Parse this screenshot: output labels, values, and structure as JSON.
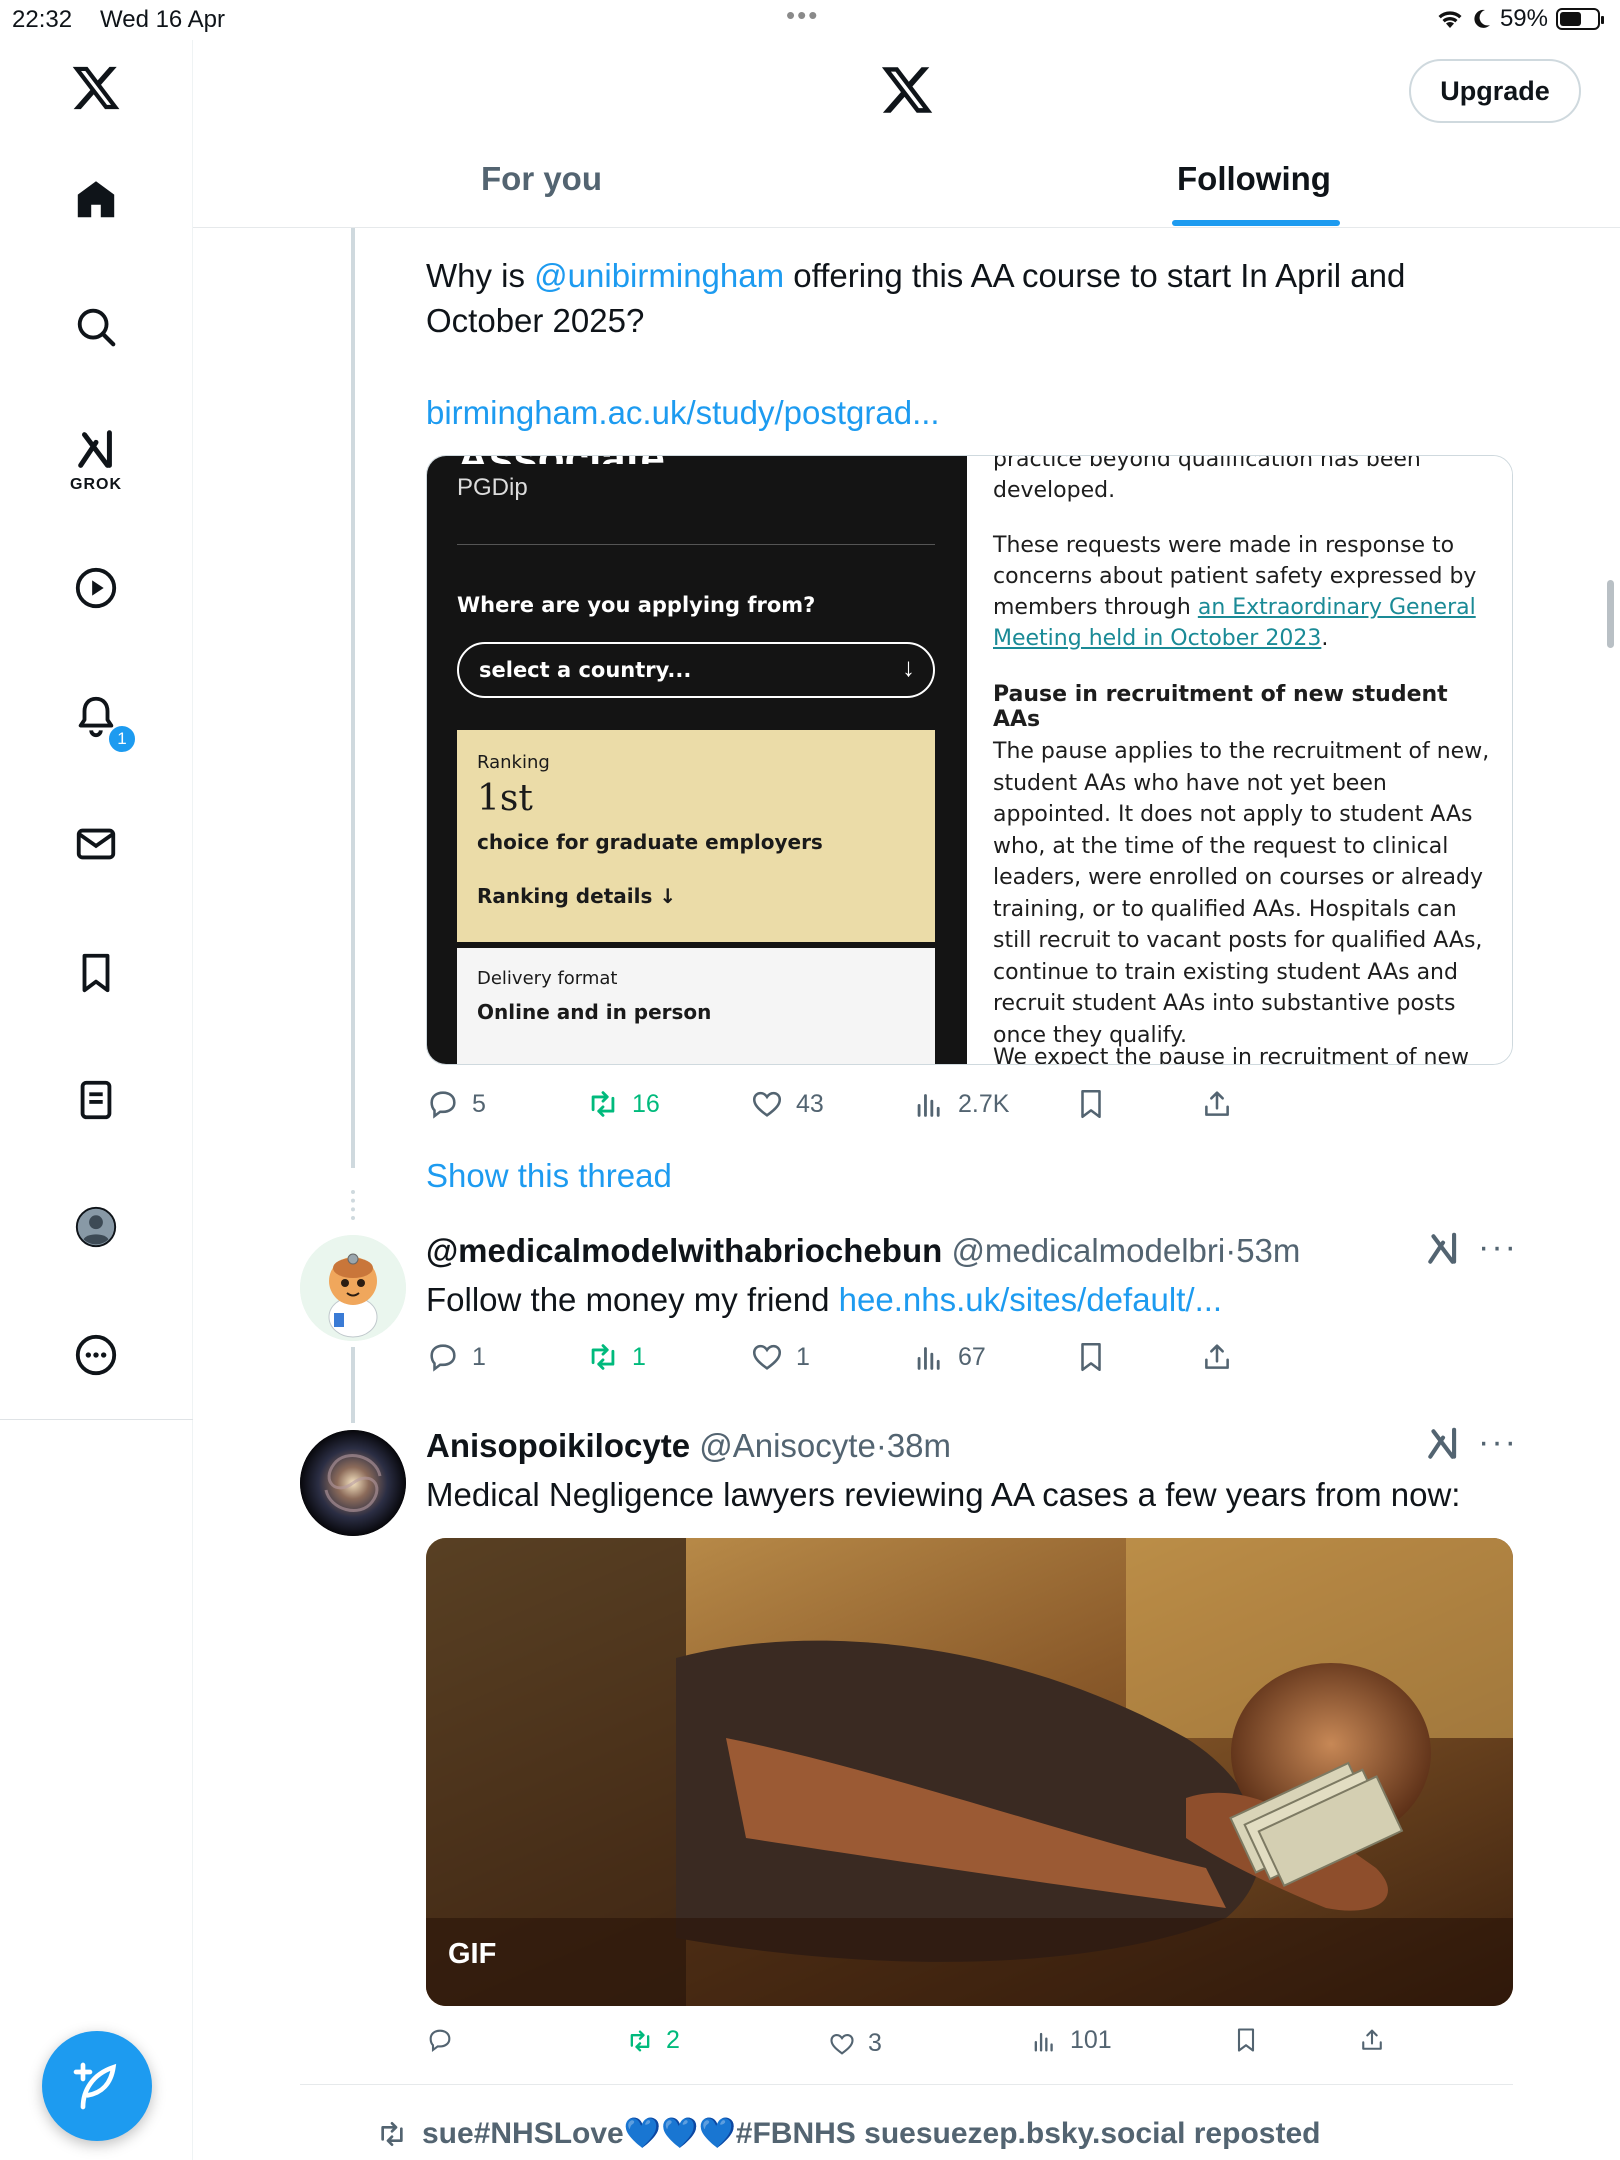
{
  "status_bar": {
    "time": "22:32",
    "date": "Wed 16 Apr",
    "battery": "59%",
    "battery_level": 0.59
  },
  "sidebar": {
    "grok_label": "GROK",
    "notification_count": "1"
  },
  "header": {
    "upgrade_label": "Upgrade",
    "tabs": [
      {
        "label": "For you",
        "active": false
      },
      {
        "label": "Following",
        "active": true
      }
    ]
  },
  "tweet1": {
    "text_before": "Why is ",
    "mention": "@unibirmingham",
    "text_after": " offering this AA course to start In April and October 2025?",
    "link": "birmingham.ac.uk/study/postgrad...",
    "card_left": {
      "heading_cut": "Associate",
      "subtitle": "PGDip",
      "question": "Where are you applying from?",
      "select_placeholder": "select a country...",
      "ranking_label": "Ranking",
      "ranking_value": "1st",
      "ranking_desc": "choice for graduate employers",
      "ranking_details": "Ranking details",
      "delivery_label": "Delivery format",
      "delivery_value": "Online and in person"
    },
    "card_right": {
      "line_top": "practice beyond qualification has been developed.",
      "para1_a": "These requests were made in response to concerns about patient safety expressed by members through ",
      "para1_link": "an Extraordinary General Meeting held in October 2023",
      "para1_b": ".",
      "heading": "Pause in recruitment of new student AAs",
      "para2": "The pause applies to the recruitment of new, student AAs who have not yet been appointed. It does not apply to student AAs who, at the time of the request to clinical leaders, were enrolled on courses or already training, or to qualified AAs. Hospitals can still recruit to vacant posts for qualified AAs, continue to train existing student AAs and recruit student AAs into substantive posts once they qualify.",
      "para3_cut": "We expect the pause in recruitment of new"
    },
    "stats": {
      "replies": "5",
      "reposts": "16",
      "likes": "43",
      "views": "2.7K"
    },
    "show_thread": "Show this thread"
  },
  "tweet2": {
    "name": "@medicalmodelwithabriochebun",
    "handle": "@medicalmodelbri",
    "time": "53m",
    "text": "Follow the money my friend ",
    "link": "hee.nhs.uk/sites/default/...",
    "stats": {
      "replies": "1",
      "reposts": "1",
      "likes": "1",
      "views": "67"
    }
  },
  "tweet3": {
    "name": "Anisopoikilocyte",
    "handle": "@Anisocyte",
    "time": "38m",
    "text": "Medical Negligence lawyers reviewing AA cases a few years from now:",
    "media_badge": "GIF",
    "stats": {
      "replies": "",
      "reposts": "2",
      "likes": "3",
      "views": "101"
    }
  },
  "repost_bar": {
    "text": "sue#NHSLove💙💙💙#FBNHS suesuezep.bsky.social reposted"
  },
  "colors": {
    "accent": "#1d9bf0",
    "repost_green": "#00ba7c",
    "muted": "#536471",
    "ranking_bg": "#ebdca8"
  },
  "icons": [
    "x-logo-icon",
    "home-icon",
    "search-icon",
    "grok-icon",
    "video-icon",
    "bell-icon",
    "mail-icon",
    "bookmark-icon",
    "list-icon",
    "profile-icon",
    "more-circle-icon",
    "compose-icon",
    "reply-icon",
    "repost-icon",
    "like-icon",
    "views-icon",
    "share-icon"
  ]
}
